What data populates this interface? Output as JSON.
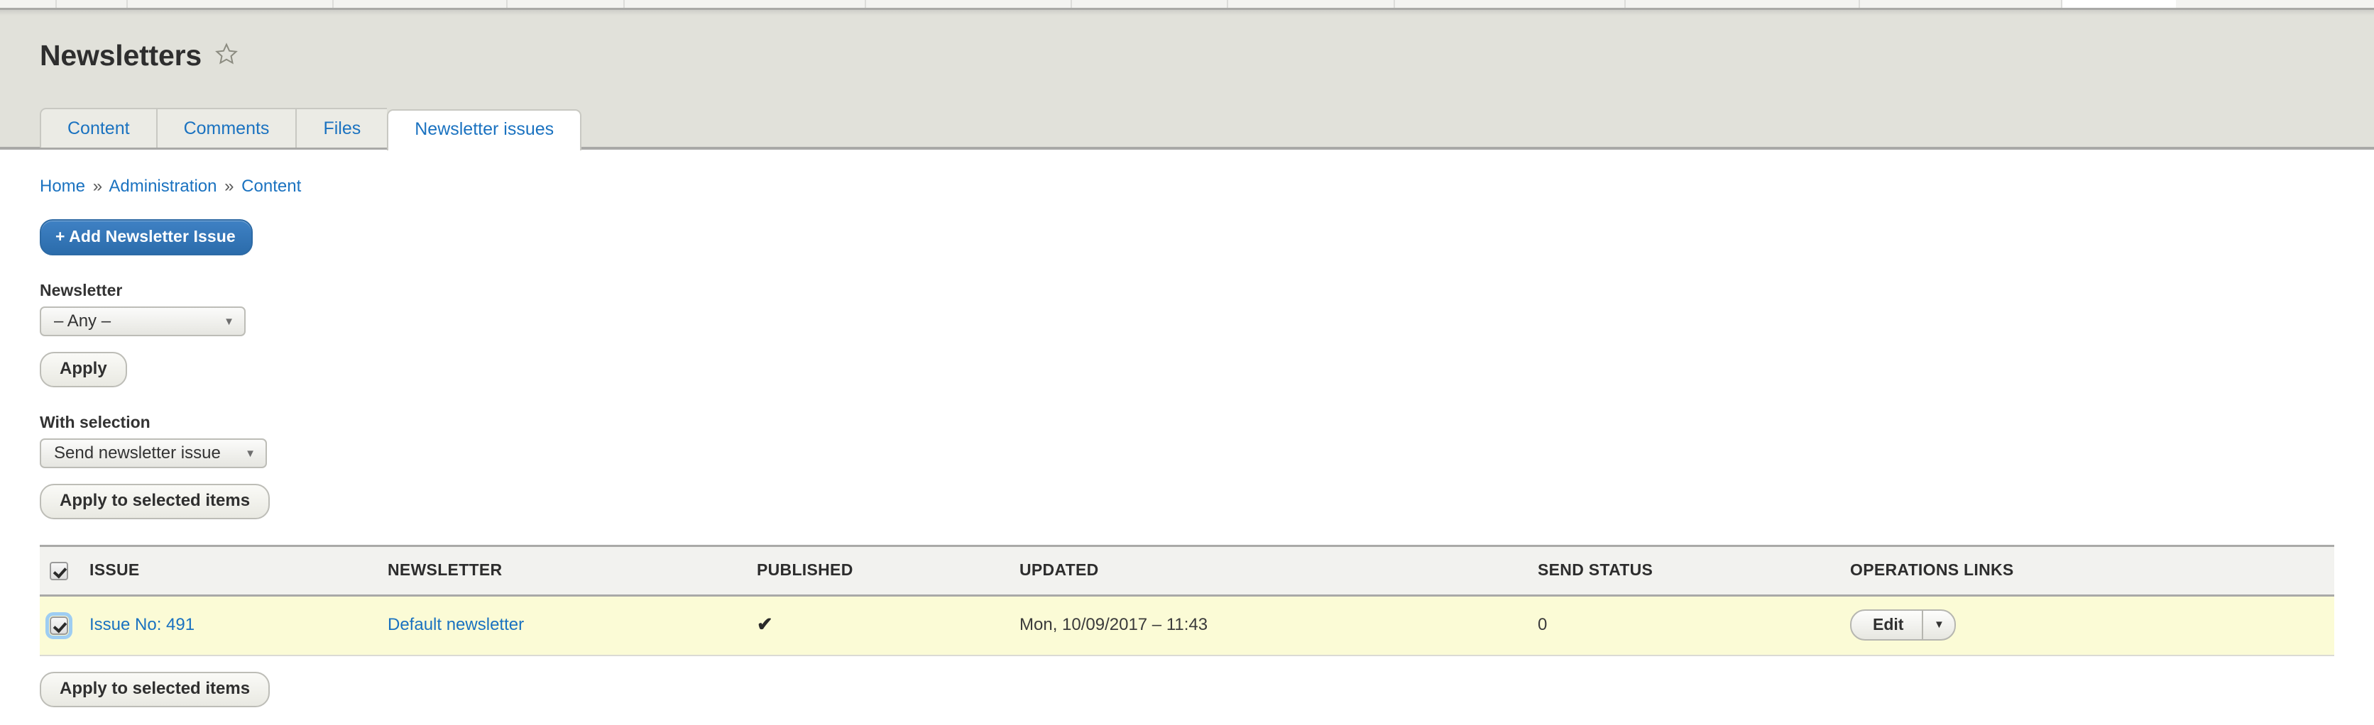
{
  "page": {
    "title": "Newsletters",
    "favorite_icon": "star-outline-icon"
  },
  "tabs": [
    {
      "label": "Content",
      "active": false
    },
    {
      "label": "Comments",
      "active": false
    },
    {
      "label": "Files",
      "active": false
    },
    {
      "label": "Newsletter issues",
      "active": true
    }
  ],
  "breadcrumb": {
    "items": [
      "Home",
      "Administration",
      "Content"
    ],
    "separator": "»"
  },
  "actions": {
    "add_issue_label": "+ Add Newsletter Issue"
  },
  "filters": {
    "newsletter_label": "Newsletter",
    "newsletter_value": "– Any –",
    "apply_label": "Apply"
  },
  "bulk": {
    "with_selection_label": "With selection",
    "action_value": "Send newsletter issue",
    "apply_selected_label": "Apply to selected items",
    "apply_selected_label_bottom": "Apply to selected items"
  },
  "table": {
    "select_all_checked": true,
    "columns": [
      "ISSUE",
      "NEWSLETTER",
      "PUBLISHED",
      "UPDATED",
      "SEND STATUS",
      "OPERATIONS LINKS"
    ],
    "rows": [
      {
        "selected": true,
        "issue": "Issue No: 491",
        "newsletter": "Default newsletter",
        "published": "✔",
        "updated": "Mon, 10/09/2017 – 11:43",
        "send_status": "0",
        "operation_label": "Edit",
        "operation_toggle_icon": "chevron-down-icon"
      }
    ]
  },
  "colors": {
    "link": "#1a72c0",
    "primary_button": "#2f72b4",
    "header_band": "#e1e1da",
    "row_highlight": "#fbfbd6",
    "table_head": "#f2f2ef"
  }
}
